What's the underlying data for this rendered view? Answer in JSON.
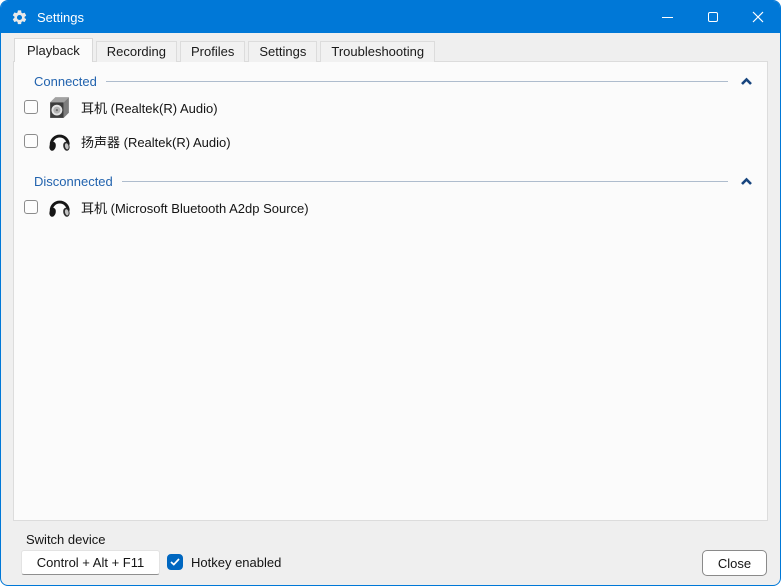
{
  "window": {
    "title": "Settings"
  },
  "tabs": [
    {
      "label": "Playback",
      "selected": true
    },
    {
      "label": "Recording",
      "selected": false
    },
    {
      "label": "Profiles",
      "selected": false
    },
    {
      "label": "Settings",
      "selected": false
    },
    {
      "label": "Troubleshooting",
      "selected": false
    }
  ],
  "groups": [
    {
      "label": "Connected",
      "devices": [
        {
          "name": "耳机 (Realtek(R) Audio)",
          "icon": "speaker",
          "checked": false
        },
        {
          "name": "扬声器 (Realtek(R) Audio)",
          "icon": "headphones",
          "checked": false
        }
      ]
    },
    {
      "label": "Disconnected",
      "devices": [
        {
          "name": "耳机 (Microsoft Bluetooth A2dp Source)",
          "icon": "headphones",
          "checked": false
        }
      ]
    }
  ],
  "footer": {
    "switch_device_label": "Switch device",
    "hotkey_value": "Control + Alt + F11",
    "hotkey_enabled_label": "Hotkey enabled",
    "hotkey_enabled_checked": true,
    "close_label": "Close"
  },
  "colors": {
    "titlebar": "#0078d7",
    "accent": "#0067c0",
    "group_label": "#2263ae",
    "chevron": "#17457e"
  }
}
